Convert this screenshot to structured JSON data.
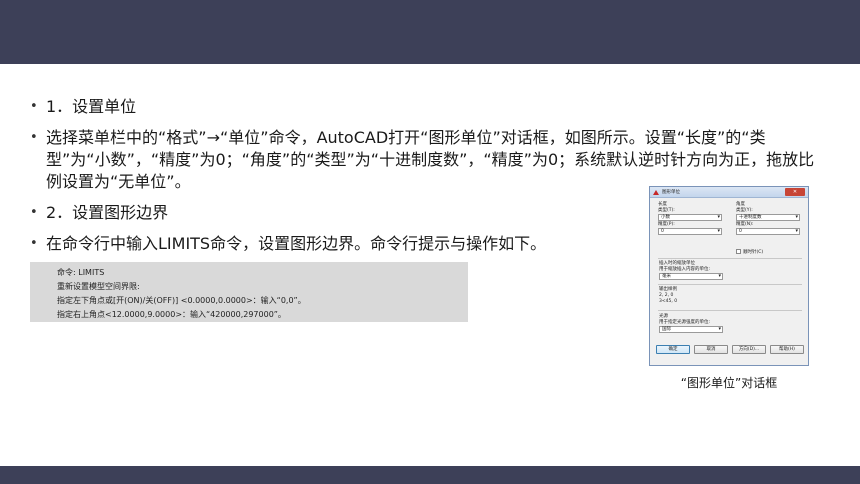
{
  "bullets": [
    "1．设置单位",
    "选择菜单栏中的“格式”→“单位”命令，AutoCAD打开“图形单位”对话框，如图所示。设置“长度”的“类型”为“小数”，“精度”为0；“角度”的“类型”为“十进制度数”，“精度”为0；系统默认逆时针方向为正，拖放比例设置为“无单位”。",
    "2．设置图形边界",
    "在命令行中输入LIMITS命令，设置图形边界。命令行提示与操作如下。"
  ],
  "command_box": {
    "lines": [
      "命令: LIMITS",
      "重新设置模型空间界限:",
      "指定左下角点或[开(ON)/关(OFF)] <0.0000,0.0000>：输入“0,0”。",
      "指定右上角点<12.0000,9.0000>：输入“420000,297000”。"
    ]
  },
  "dialog": {
    "title": "图形单位",
    "close_label": "✕",
    "length": {
      "heading": "长度",
      "type_label": "类型(T):",
      "type_value": "小数",
      "precision_label": "精度(P):",
      "precision_value": "0"
    },
    "angle": {
      "heading": "角度",
      "type_label": "类型(Y):",
      "type_value": "十进制度数",
      "precision_label": "精度(N):",
      "precision_value": "0"
    },
    "clockwise_label": "顺时针(C)",
    "insertion": {
      "heading": "插入时的缩放单位",
      "sub": "用于缩放插入内容的单位:",
      "value": "毫米"
    },
    "sample": {
      "heading": "输出样例",
      "line1": "2, 2, 0",
      "line2": "3<45, 0"
    },
    "lighting": {
      "heading": "光源",
      "sub": "用于指定光源强度的单位:",
      "value": "国际"
    },
    "buttons": {
      "ok": "确定",
      "cancel": "取消",
      "direction": "方向(D)...",
      "help": "帮助(H)"
    }
  },
  "caption": "“图形单位”对话框",
  "colors": {
    "header_bar": "#3d4058",
    "command_box_bg": "#d9d9d9"
  }
}
